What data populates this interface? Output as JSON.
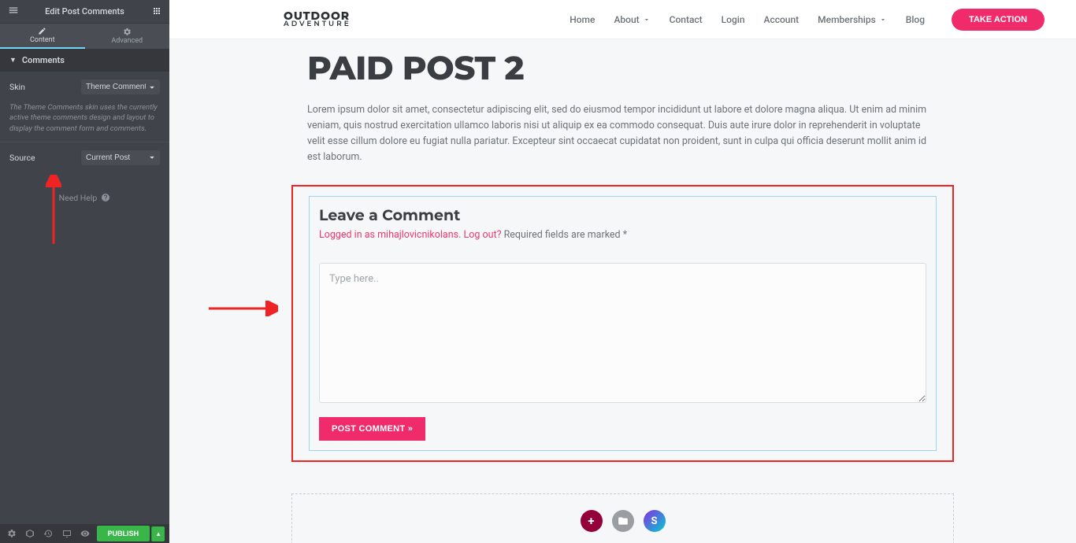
{
  "panel": {
    "title": "Edit Post Comments",
    "tabs": {
      "content": "Content",
      "advanced": "Advanced"
    },
    "section": "Comments",
    "skin_label": "Skin",
    "skin_value": "Theme Comments",
    "skin_desc": "The Theme Comments skin uses the currently active theme comments design and layout to display the comment form and comments.",
    "source_label": "Source",
    "source_value": "Current Post",
    "need_help": "Need Help",
    "publish": "PUBLISH"
  },
  "site": {
    "logo_top": "OUTDOOR",
    "logo_bot": "ADVENTURE",
    "nav": [
      "Home",
      "About",
      "Contact",
      "Login",
      "Account",
      "Memberships",
      "Blog"
    ],
    "cta": "TAKE ACTION"
  },
  "post": {
    "title": "PAID POST 2",
    "body": "Lorem ipsum dolor sit amet, consectetur adipiscing elit, sed do eiusmod tempor incididunt ut labore et dolore magna aliqua. Ut enim ad minim veniam, quis nostrud exercitation ullamco laboris nisi ut aliquip ex ea commodo consequat. Duis aute irure dolor in reprehenderit in voluptate velit esse cillum dolore eu fugiat nulla pariatur. Excepteur sint occaecat cupidatat non proident, sunt in culpa qui officia deserunt mollit anim id est laborum."
  },
  "comments": {
    "heading": "Leave a Comment",
    "logged_in": "Logged in as mihajlovicnikolans",
    "logout": "Log out?",
    "required": "Required fields are marked *",
    "placeholder": "Type here..",
    "submit": "POST COMMENT »"
  }
}
